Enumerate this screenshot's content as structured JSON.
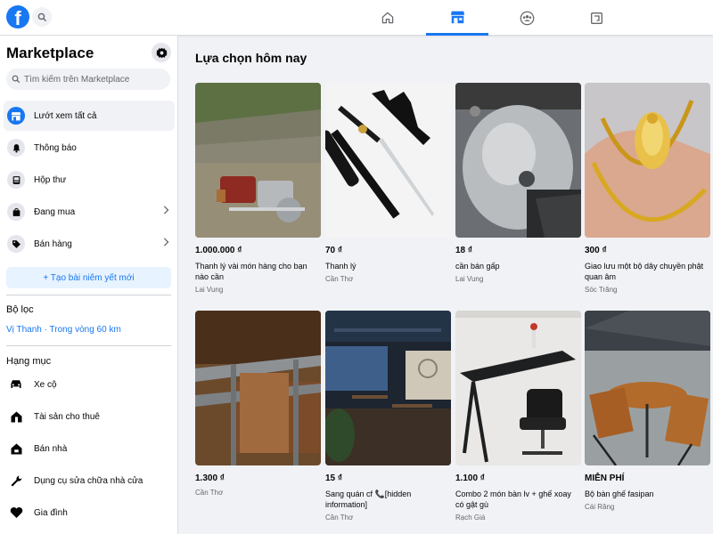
{
  "topbar": {
    "logo_letter": "f",
    "nav": [
      {
        "name": "home",
        "icon": "home-icon"
      },
      {
        "name": "marketplace",
        "icon": "marketplace-icon",
        "active": true
      },
      {
        "name": "groups",
        "icon": "groups-icon"
      },
      {
        "name": "gaming",
        "icon": "gaming-icon"
      }
    ],
    "accent_color": "#1877f2"
  },
  "sidebar": {
    "title": "Marketplace",
    "search_placeholder": "Tìm kiếm trên Marketplace",
    "items": [
      {
        "label": "Lướt xem tất cả",
        "icon": "storefront-icon",
        "active": true
      },
      {
        "label": "Thông báo",
        "icon": "bell-icon"
      },
      {
        "label": "Hộp thư",
        "icon": "inbox-icon"
      },
      {
        "label": "Đang mua",
        "icon": "bag-icon",
        "chevron": true
      },
      {
        "label": "Bán hàng",
        "icon": "tag-icon",
        "chevron": true
      }
    ],
    "create_listing": "+ Tạo bài niêm yết mới",
    "filter_heading": "Bộ lọc",
    "location": "Vị Thanh · Trong vòng 60 km",
    "category_heading": "Hạng mục",
    "categories": [
      {
        "label": "Xe cộ",
        "icon": "car-icon"
      },
      {
        "label": "Tài sản cho thuê",
        "icon": "house-key-icon"
      },
      {
        "label": "Bán nhà",
        "icon": "house-tag-icon"
      },
      {
        "label": "Dụng cụ sửa chữa nhà cửa",
        "icon": "wrench-icon"
      },
      {
        "label": "Gia đình",
        "icon": "heart-icon"
      }
    ]
  },
  "main": {
    "title": "Lựa chọn hôm nay",
    "listings": [
      {
        "price": "1.000.000 ₫",
        "title": "Thanh lý vài món hàng cho bạn nào cần",
        "location": "Lai Vung",
        "image": "pressure-washer-photo"
      },
      {
        "price": "70 ₫",
        "title": "Thanh lý",
        "location": "Cần Thơ",
        "image": "katana-sword-photo"
      },
      {
        "price": "18 ₫",
        "title": "cần bán gấp",
        "location": "Lai Vung",
        "image": "motorbike-engine-photo"
      },
      {
        "price": "300 ₫",
        "title": "Giao lưu một bộ dây chuyền phật quan âm",
        "location": "Sóc Trăng",
        "image": "gold-necklace-photo"
      },
      {
        "price": "1.300 ₫",
        "title": "",
        "location": "Cần Thơ",
        "image": "metal-frame-photo"
      },
      {
        "price": "15 ₫",
        "title": "Sang quán cf 📞[hidden information]",
        "location": "Cần Thơ",
        "image": "cafe-night-photo"
      },
      {
        "price": "1.100 ₫",
        "title": "Combo 2 món bàn lv + ghế xoay có gật gù",
        "location": "Rạch Giá",
        "image": "desk-chair-photo"
      },
      {
        "price": "MIỄN PHÍ",
        "title": "Bộ bàn ghế fasipan",
        "location": "Cái Răng",
        "image": "wooden-chairs-photo"
      }
    ]
  }
}
